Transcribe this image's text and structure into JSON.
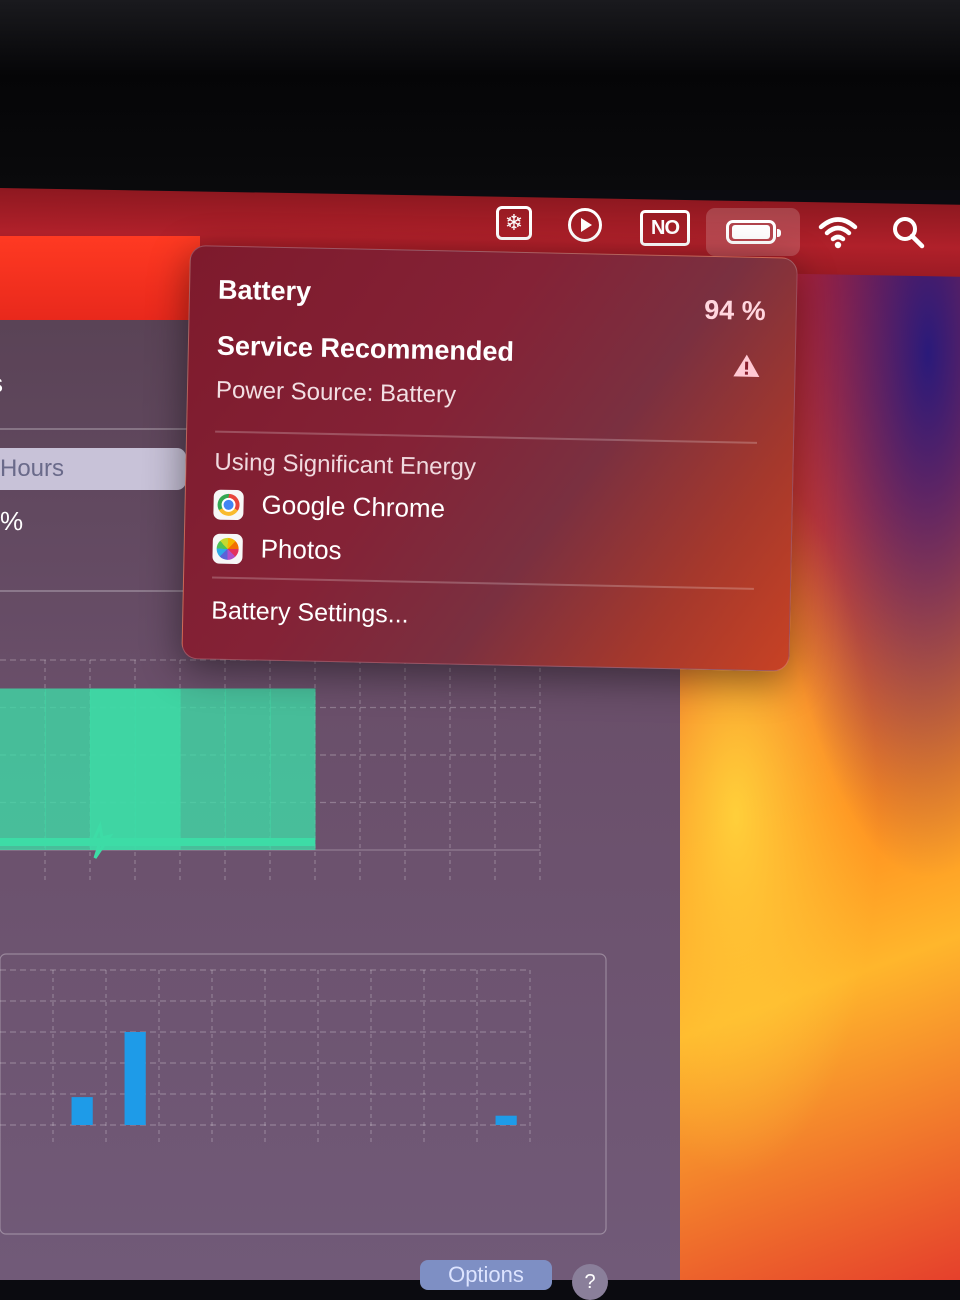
{
  "menubar": {
    "icons": [
      "snowflake-icon",
      "play-circle-icon",
      "no-badge-icon",
      "battery-icon",
      "wifi-icon",
      "search-icon"
    ],
    "no_label": "NO",
    "snowflake_glyph": "❄"
  },
  "battery_menu": {
    "title": "Battery",
    "percent": "94 %",
    "level": 0.94,
    "condition": "Service Recommended",
    "power_source": "Power Source: Battery",
    "energy_heading": "Using Significant Energy",
    "apps": [
      "Google Chrome",
      "Photos"
    ],
    "settings_link": "Battery Settings..."
  },
  "battery_window": {
    "segment_label": "Hours",
    "percent_fragment": "%",
    "options_label": "Options",
    "help_label": "?"
  },
  "colors": {
    "menubar": "#b0202a",
    "battery_level_bar": "#3ddca6",
    "energy_usage_bar": "#1e9be8"
  },
  "chart_data": [
    {
      "type": "area",
      "series": [
        {
          "values": [
            85,
            85,
            85,
            85,
            85,
            85,
            85,
            0
          ]
        }
      ],
      "ylim": [
        0,
        100
      ]
    },
    {
      "type": "bar",
      "series": [
        {
          "values": [
            0,
            18,
            60,
            0,
            0,
            0,
            0,
            0,
            0,
            6
          ]
        }
      ]
    }
  ]
}
